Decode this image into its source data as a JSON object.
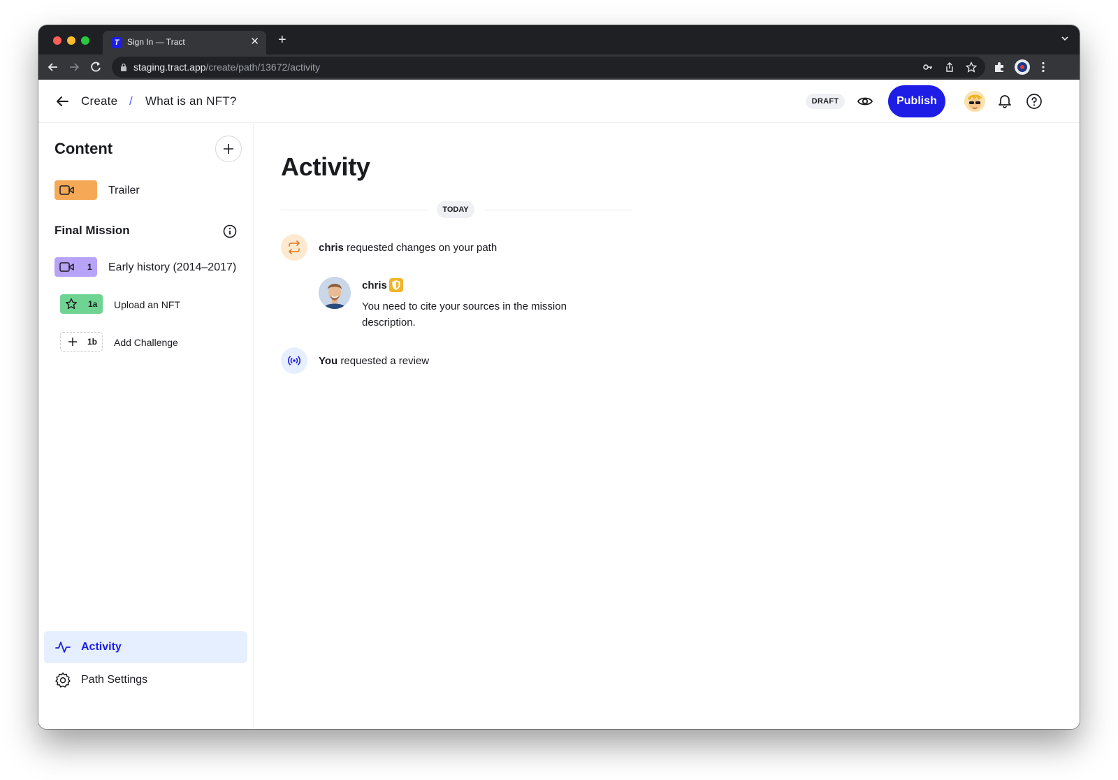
{
  "browser": {
    "tab_title": "Sign In — Tract",
    "tab_favicon_letter": "T",
    "url_host": "staging.tract.app",
    "url_path": "/create/path/13672/activity"
  },
  "header": {
    "breadcrumb_root": "Create",
    "breadcrumb_separator": "/",
    "breadcrumb_current": "What is an NFT?",
    "status_badge": "DRAFT",
    "publish_label": "Publish"
  },
  "sidebar": {
    "title": "Content",
    "trailer": {
      "label": "Trailer",
      "icon": "video-icon",
      "color": "#f5a957"
    },
    "section_title": "Final Mission",
    "items": [
      {
        "number": "1",
        "label": "Early history (2014–2017)",
        "icon": "video-icon",
        "color": "#b7a3f7"
      },
      {
        "number": "1a",
        "label": "Upload an NFT",
        "icon": "star-icon",
        "color": "#6fd492"
      },
      {
        "number": "1b",
        "label": "Add Challenge",
        "icon": "plus-icon",
        "color": "#ffffff"
      }
    ],
    "nav": [
      {
        "label": "Activity",
        "icon": "activity-icon",
        "active": true
      },
      {
        "label": "Path Settings",
        "icon": "gear-icon",
        "active": false
      }
    ]
  },
  "main": {
    "title": "Activity",
    "date_label": "TODAY",
    "events": [
      {
        "actor": "chris",
        "text": "requested changes on your path",
        "icon": "swap-arrows-icon",
        "color": "#fde9cf"
      },
      {
        "actor": "You",
        "text": "requested a review",
        "icon": "broadcast-icon",
        "color": "#e6efff"
      }
    ],
    "comment": {
      "author": "chris",
      "body": "You need to cite your sources in the mission description."
    }
  },
  "colors": {
    "accent": "#1d1de6",
    "active_nav_bg": "#e6efff",
    "reviewer_badge": "#f0b429"
  }
}
